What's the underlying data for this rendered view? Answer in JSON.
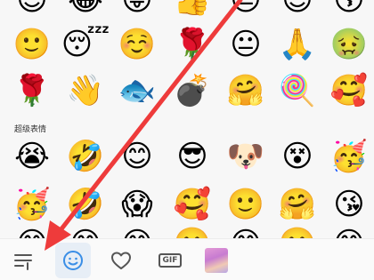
{
  "emoji_rows": [
    {
      "cells": [
        "😊",
        "😂",
        "😜",
        "👍",
        "😐",
        "😍",
        "😚"
      ]
    },
    {
      "cells": [
        "🙂",
        "😴",
        "☺️",
        "🌹",
        "😐",
        "🙏",
        "🤢"
      ]
    },
    {
      "cells": [
        "🌹",
        "👋",
        "🐟",
        "💣",
        "🤗",
        "🍭",
        "🥰"
      ]
    }
  ],
  "section_title": "超级表情",
  "super_rows": [
    {
      "cells": [
        "😭",
        "🤣",
        "😊",
        "😎",
        "🐶",
        "😵",
        "🥳"
      ]
    },
    {
      "cells": [
        "🥳",
        "🤣",
        "😱",
        "🥰",
        "🙂",
        "🤗",
        "😘"
      ]
    },
    {
      "cells": [
        "😁",
        "😊",
        "😄",
        "🙂",
        "😄",
        "🙂",
        "😊"
      ]
    }
  ],
  "toolbar": {
    "gif_label": "GIF"
  },
  "colors": {
    "arrow": "#ee3b3b",
    "active_tab_bg": "#e7eef6",
    "accent": "#3a8ee6"
  }
}
